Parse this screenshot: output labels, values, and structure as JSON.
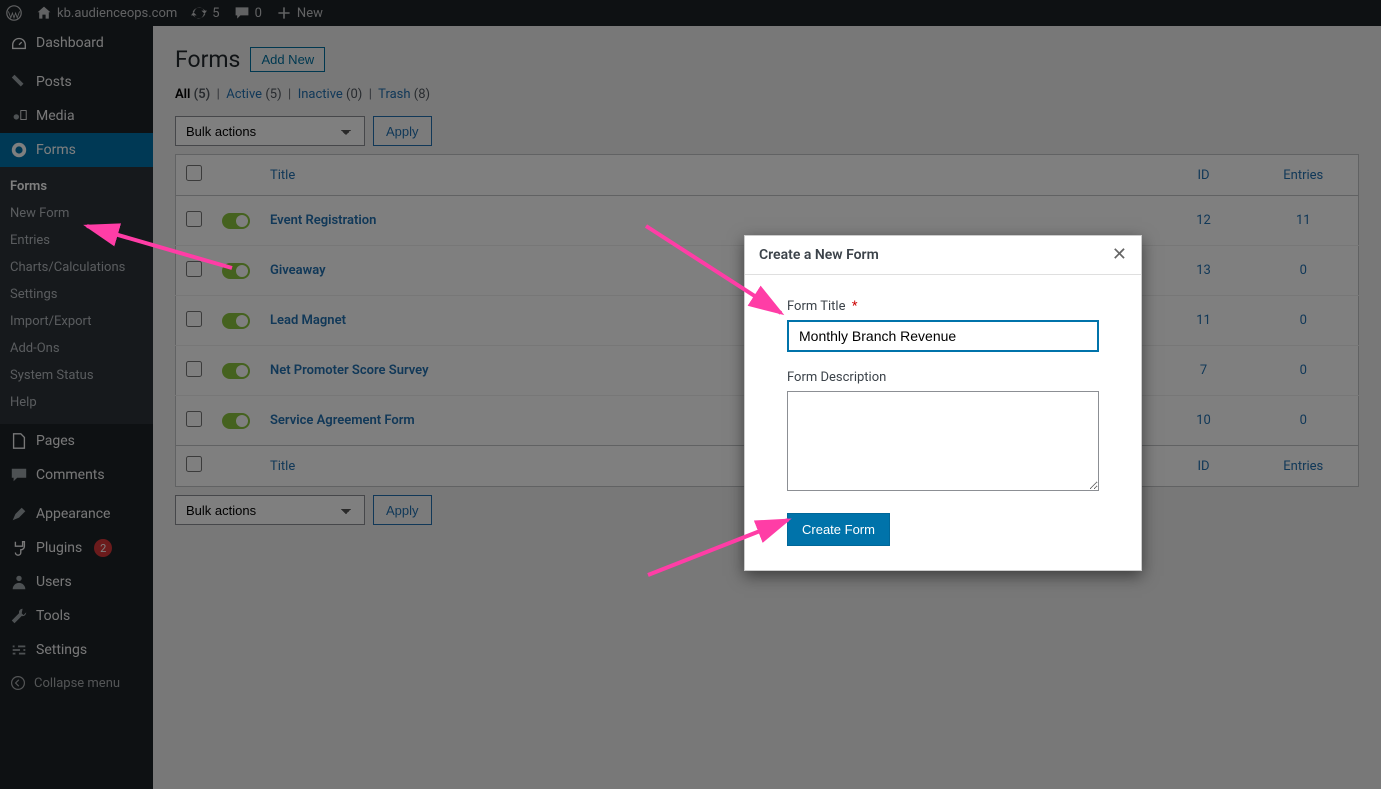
{
  "adminbar": {
    "site": "kb.audienceops.com",
    "updates": "5",
    "comments": "0",
    "new": "New"
  },
  "sidebar": {
    "dashboard": "Dashboard",
    "posts": "Posts",
    "media": "Media",
    "forms": "Forms",
    "submenu": {
      "forms": "Forms",
      "newform": "New Form",
      "entries": "Entries",
      "charts": "Charts/Calculations",
      "settings": "Settings",
      "importexport": "Import/Export",
      "addons": "Add-Ons",
      "systemstatus": "System Status",
      "help": "Help"
    },
    "pages": "Pages",
    "comments": "Comments",
    "appearance": "Appearance",
    "plugins": "Plugins",
    "plugins_badge": "2",
    "users": "Users",
    "tools": "Tools",
    "settings": "Settings",
    "collapse": "Collapse menu"
  },
  "page": {
    "title": "Forms",
    "addnew_btn": "Add New",
    "subsub": {
      "all_label": "All",
      "all_count": "(5)",
      "active_label": "Active",
      "active_count": "(5)",
      "inactive_label": "Inactive",
      "inactive_count": "(0)",
      "trash_label": "Trash",
      "trash_count": "(8)"
    },
    "bulk_option": "Bulk actions",
    "apply_btn": "Apply"
  },
  "cols": {
    "title": "Title",
    "id": "ID",
    "entries": "Entries"
  },
  "rows": [
    {
      "title": "Event Registration",
      "id": "12",
      "entries": "11"
    },
    {
      "title": "Giveaway",
      "id": "13",
      "entries": "0"
    },
    {
      "title": "Lead Magnet",
      "id": "11",
      "entries": "0"
    },
    {
      "title": "Net Promoter Score Survey",
      "id": "7",
      "entries": "0"
    },
    {
      "title": "Service Agreement Form",
      "id": "10",
      "entries": "0"
    }
  ],
  "modal": {
    "title": "Create a New Form",
    "form_title_label": "Form Title",
    "form_title_value": "Monthly Branch Revenue",
    "form_desc_label": "Form Description",
    "form_desc_value": "",
    "create_btn": "Create Form"
  }
}
